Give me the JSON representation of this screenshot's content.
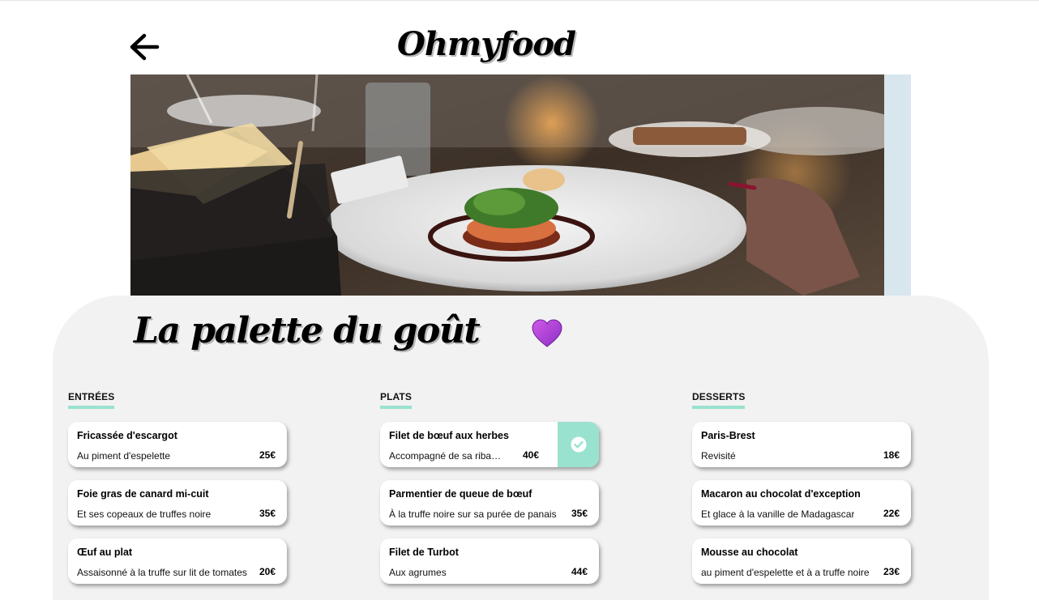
{
  "header": {
    "logo": "Ohmyfood",
    "back_icon": "arrow-left-icon"
  },
  "hero": {
    "image": "restaurant-dish-photo"
  },
  "restaurant": {
    "name": "La palette du goût",
    "like_icon": "heart-icon",
    "like_color": "#b43fd4"
  },
  "colors": {
    "accent": "#99e2d0",
    "panel": "#f2f2f2"
  },
  "menu": {
    "entrees": {
      "title": "Entrées",
      "dishes": [
        {
          "name": "Fricassée d'escargot",
          "desc": "Au piment d'espelette",
          "price": "25€"
        },
        {
          "name": "Foie gras de canard mi-cuit",
          "desc": "Et ses copeaux de truffes noire",
          "price": "35€"
        },
        {
          "name": "Œuf au plat",
          "desc": "Assaisonné à la truffe sur lit de tomates",
          "price": "20€"
        }
      ]
    },
    "plats": {
      "title": "Plats",
      "dishes": [
        {
          "name": "Filet de bœuf aux herbes",
          "desc": "Accompagné de sa ribambelle de légumes",
          "price": "40€",
          "selected": true
        },
        {
          "name": "Parmentier de queue de bœuf",
          "desc": "À la truffe noire sur sa purée de panais",
          "price": "35€"
        },
        {
          "name": "Filet de Turbot",
          "desc": "Aux agrumes",
          "price": "44€"
        }
      ]
    },
    "desserts": {
      "title": "Desserts",
      "dishes": [
        {
          "name": "Paris-Brest",
          "desc": "Revisité",
          "price": "18€"
        },
        {
          "name": "Macaron au chocolat d'exception",
          "desc": "Et glace à la vanille de Madagascar",
          "price": "22€"
        },
        {
          "name": "Mousse au chocolat",
          "desc": "au piment d'espelette et à a truffe noire",
          "price": "23€"
        }
      ]
    }
  }
}
